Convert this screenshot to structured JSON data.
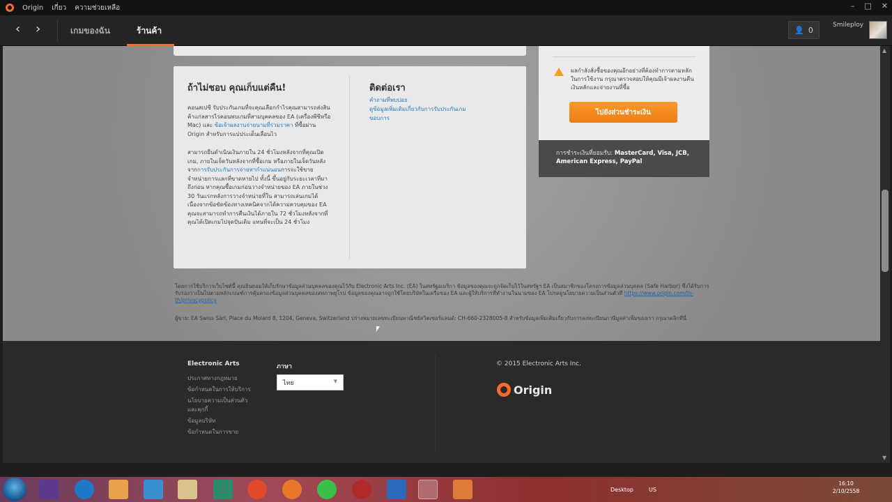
{
  "window": {
    "title": "Origin",
    "menu": [
      "เกี่ยว",
      "ความช่วยเหลือ"
    ],
    "controls": [
      "–",
      "□",
      "✕"
    ]
  },
  "nav": {
    "back": "‹",
    "forward": "›",
    "tabs": [
      {
        "label": "เกมของฉัน",
        "active": false
      },
      {
        "label": "ร้านค้า",
        "active": true
      }
    ],
    "friends_count": "0",
    "username": "Smileploy"
  },
  "refund": {
    "title": "ถ้าไม่ชอบ คุณเก็บแต่คืน!",
    "p1_pre": "คอนสเปซี รับประกันเกมที่จะคุณเลือกกำไรคุณสามารถส่งสินค้าแก่ลสารไรคอนพบเกมที่สามบุคคลของ EA (เครื่องพีซีหรือ Mac) และ ",
    "p1_link": "ข้อเจ้าผลงานจ่ายนามที่ร่วมราคา",
    "p1_post": " ที่ซื้อผ่าน Origin สำหรับการแบ่ประเด็นเลื่อนไว",
    "p2_pre": "สามารถยืนดำเนินเงินภายใน 24 ชั่วโมงหลังจากที่คุณเปิดเกม, ภายในเจ็ดวันหลังจากที่ซื้อเกม หรือภายในเจ็ดวันหลังจาก",
    "p2_link": "การรับประกันการจ่ายหากำแน่นอน",
    "p2_post": "การจะใช้ขายจำหน่ายการแลกที่ขาดหายไป ทั้งนี้ ขึ้นอยู่กับระยะเวลาที่มาถึงก่อน หากคุณซื้อเกมก่อนวางจำหน่ายของ EA ภายในช่วง 30 วันแรกหลังการวางจำหน่ายที่ใน สามารถเล่นเกมได้เนื่องจากข้อขัดข้องทางเทคนิคจากได้ความควบคุมของ EA คุณจะสามารถทำการคืนเงินได้ภายใน 72 ชั่วโมงหลังจากที่คุณได้เปิดเกมไปจุดปันเติม แทนที่จะเป็น 24 ชั่วโมง"
  },
  "contact": {
    "title": "ติดต่อเรา",
    "links": [
      "คำถามที่พบบ่อย",
      "ดูข้อมูลเพิ่มเติมเกี่ยวกับการรับประกันเกม",
      "ขอบการ"
    ]
  },
  "payment": {
    "warning": "ผลกำลังสั่งซื้อของคุณอีกอย่างที่ต้องทำการตามหลักในการใช้งาน กรุณาตรวจสอบให้คุณมีเจ้าผลงานคืนเงินหลักและจ่ายงานที่ซื้อ",
    "button": "ไปยังส่วนชำระเงิน",
    "methods_label": "การชำระเงินที่ยอมรับ:",
    "methods": "MasterCard, Visa, JCB, American Express, PayPal"
  },
  "legal": {
    "privacy_pre": "โดยการใช้บริการเว็บไซต์นี้ คุณยินยอมให้เก็บรักษาข้อมูลส่วนบุคคลของคุณไว้กับ Electronic Arts Inc. (EA) ในสหรัฐอเมริกา ข้อมูลของคุณจะถูกจัดเก็บไว้ในสหรัฐฯ EA เป็นสมาชิกของโครงการข้อมูลส่วนบุคคล (Safe Harbor) ซึ่งได้รับการรับรองว่าเป็นไปตามหลักเกณฑ์การคุ้มครองข้อมูลส่วนบุคคลของสหภาพยุโรป ข้อมูลของคุณอาจถูกใช้โดยบริษัทในเครือของ EA และผู้ให้บริการที่ทำงานในนามของ EA โปรดดูนโยบายความเป็นส่วนตัวที่ ",
    "privacy_link": "https://www.origin.com/th-th/privacypolicy",
    "address": "ผู้ขาย: EA Swiss Sàrl, Place du Molard 8, 1204, Geneva, Switzerland ปร่างหมายเลขทะเบียนพาณิชย์สวิตเซอร์แลนด์: CH-660-2328005-8 สำหรับข้อมูลเพิ่มเติมเกี่ยวกับการลงทะเบียนภาษีมูลค่าเพิ่มของเรา กรุณาคลิกที่นี่"
  },
  "footer": {
    "col1_title": "Electronic Arts",
    "col1_links": [
      "ประกาศทางกฎหมาย",
      "ข้อกำหนดในการให้บริการ",
      "นโยบายความเป็นส่วนตัวและคุกกี้",
      "ข้อมูลบริษัท",
      "ข้อกำหนดในการขาย"
    ],
    "lang_title": "ภาษา",
    "lang_value": "ไทย",
    "copyright": "© 2015 Electronic Arts Inc.",
    "brand": "Origin"
  },
  "taskbar": {
    "desktop_label": "Desktop",
    "lang": "US",
    "time": "16:10",
    "date": "2/10/2558"
  }
}
